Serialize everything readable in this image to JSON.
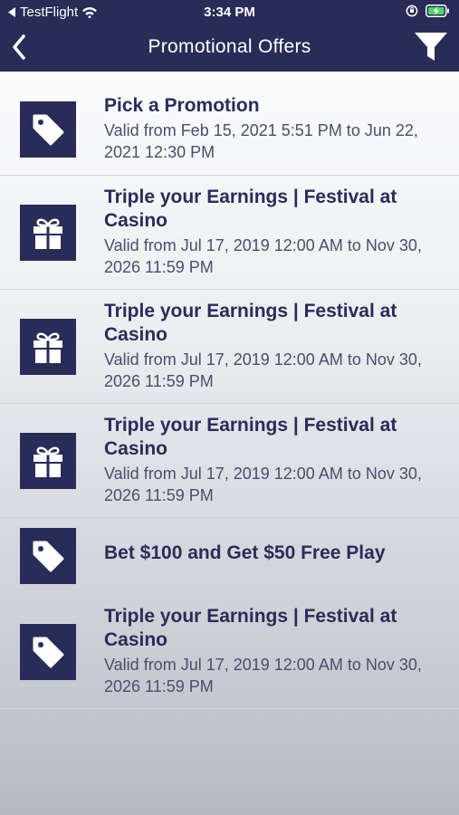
{
  "status": {
    "carrier": "TestFlight",
    "time": "3:34 PM"
  },
  "header": {
    "title": "Promotional Offers"
  },
  "icons": {
    "back": "chevron-left-icon",
    "filter": "filter-icon",
    "tag": "tag-icon",
    "gift": "gift-icon"
  },
  "colors": {
    "primary": "#2a2c58",
    "text_secondary": "#4b4d6c"
  },
  "promotions": [
    {
      "icon": "tag",
      "title": "Pick a Promotion",
      "validity": "Valid from Feb 15, 2021 5:51 PM to Jun 22, 2021 12:30 PM"
    },
    {
      "icon": "gift",
      "title": "Triple your Earnings | Festival at Casino",
      "validity": "Valid from Jul 17, 2019 12:00 AM to Nov 30, 2026 11:59 PM"
    },
    {
      "icon": "gift",
      "title": "Triple your Earnings | Festival at Casino",
      "validity": "Valid from Jul 17, 2019 12:00 AM to Nov 30, 2026 11:59 PM"
    },
    {
      "icon": "gift",
      "title": "Triple your Earnings | Festival at Casino",
      "validity": "Valid from Jul 17, 2019 12:00 AM to Nov 30, 2026 11:59 PM"
    },
    {
      "icon": "tag",
      "title": "Bet $100 and Get $50 Free Play",
      "validity": ""
    },
    {
      "icon": "tag",
      "title": "Triple your Earnings | Festival at Casino",
      "validity": "Valid from Jul 17, 2019 12:00 AM to Nov 30, 2026 11:59 PM"
    }
  ]
}
